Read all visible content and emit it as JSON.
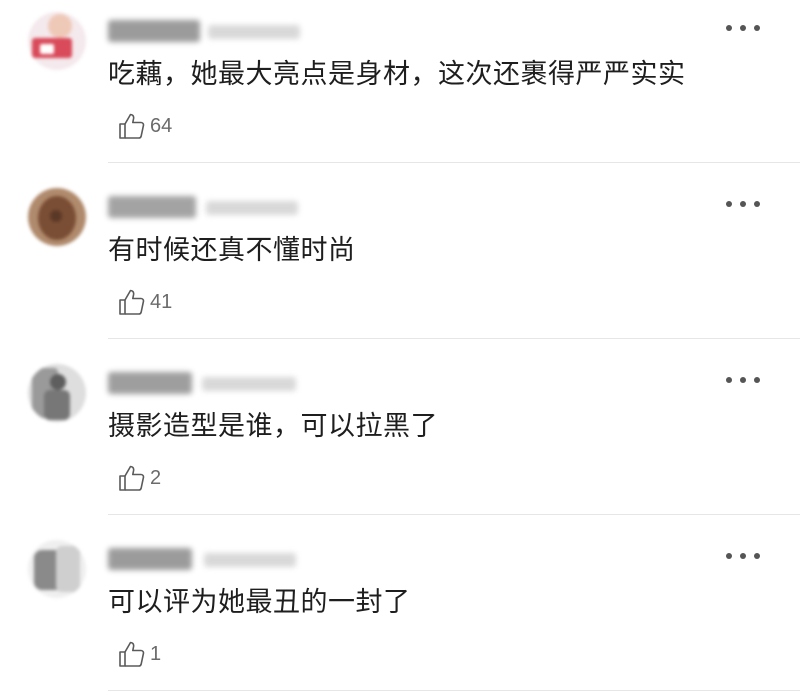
{
  "comments": [
    {
      "content": "吃藕，她最大亮点是身材，这次还裹得严严实实",
      "likes": "64",
      "avatar_colors": [
        "#f4e9ec",
        "#d94a5a",
        "#efc9b8"
      ]
    },
    {
      "content": "有时候还真不懂时尚",
      "likes": "41",
      "avatar_colors": [
        "#b08a6c",
        "#7a4e35",
        "#5b3826"
      ]
    },
    {
      "content": "摄影造型是谁，可以拉黑了",
      "likes": "2",
      "avatar_colors": [
        "#9a9a9a",
        "#dedede",
        "#5e5e5e"
      ]
    },
    {
      "content": "可以评为她最丑的一封了",
      "likes": "1",
      "avatar_colors": [
        "#cfcfcf",
        "#8a8a8a",
        "#efefef"
      ]
    }
  ],
  "icons": {
    "more": "more-dots-icon",
    "like": "thumbs-up-icon"
  },
  "colors": {
    "text": "#1e1e1e",
    "secondary": "#6b6b6b",
    "divider": "#e6e6e6"
  }
}
